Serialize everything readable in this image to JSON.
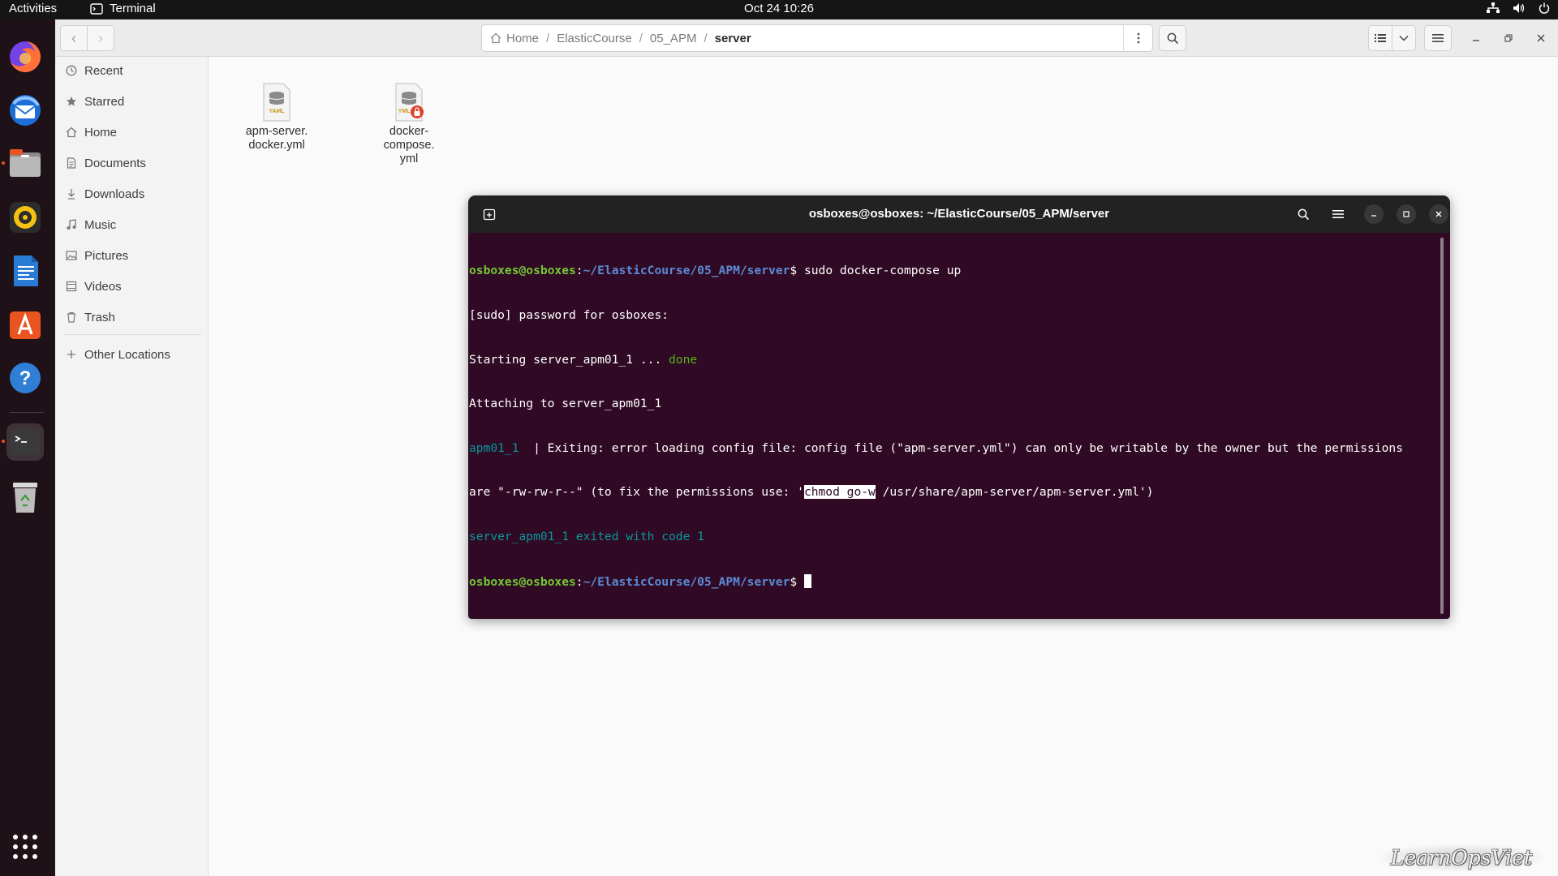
{
  "topbar": {
    "activities": "Activities",
    "app_name": "Terminal",
    "clock": "Oct 24  10:26"
  },
  "dock": {
    "items": [
      "firefox-icon",
      "thunderbird-icon",
      "files-icon",
      "rhythmbox-icon",
      "writer-icon",
      "software-icon",
      "help-icon",
      "terminal-icon",
      "trash-icon"
    ],
    "apps_grid": "show-apps-icon"
  },
  "files": {
    "path": [
      "Home",
      "ElasticCourse",
      "05_APM",
      "server"
    ],
    "sidebar": [
      {
        "label": "Recent",
        "icon": "clock-icon"
      },
      {
        "label": "Starred",
        "icon": "star-icon"
      },
      {
        "label": "Home",
        "icon": "home-icon"
      },
      {
        "label": "Documents",
        "icon": "document-icon"
      },
      {
        "label": "Downloads",
        "icon": "download-icon"
      },
      {
        "label": "Music",
        "icon": "music-icon"
      },
      {
        "label": "Pictures",
        "icon": "picture-icon"
      },
      {
        "label": "Videos",
        "icon": "video-icon"
      },
      {
        "label": "Trash",
        "icon": "trash-icon"
      },
      {
        "label": "Other Locations",
        "icon": "plus-icon"
      }
    ],
    "items": [
      {
        "name_line1": "apm-server.",
        "name_line2": "docker.yml",
        "name_line3": "",
        "icon_label": "YAML",
        "locked": false
      },
      {
        "name_line1": "docker-",
        "name_line2": "compose.",
        "name_line3": "yml",
        "icon_label": "YML",
        "locked": true
      }
    ]
  },
  "terminal": {
    "title": "osboxes@osboxes: ~/ElasticCourse/05_APM/server",
    "prompt_user": "osboxes@osboxes",
    "prompt_sep": ":",
    "prompt_path": "~/ElasticCourse/05_APM/server",
    "prompt_dollar": "$ ",
    "command": "sudo docker-compose up",
    "line2": "[sudo] password for osboxes:",
    "line3_a": "Starting server_apm01_1 ... ",
    "line3_b": "done",
    "line4": "Attaching to server_apm01_1",
    "line5_svc": "apm01_1  ",
    "line5_msg": "| Exiting: error loading config file: config file (\"apm-server.yml\") can only be writable by the owner but the permissions",
    "line6_a": "are \"-rw-rw-r--\" (to fix the permissions use: '",
    "line6_sel": "chmod go-w",
    "line6_b": " /usr/share/apm-server/apm-server.yml')",
    "line7": "server_apm01_1 exited with code 1"
  },
  "watermark": "LearnOpsViet",
  "colors": {
    "terminal_bg": "#300a24",
    "prompt_user": "#73c936",
    "prompt_path": "#5c8ad6",
    "service": "#06989a",
    "accent": "#e95420"
  }
}
